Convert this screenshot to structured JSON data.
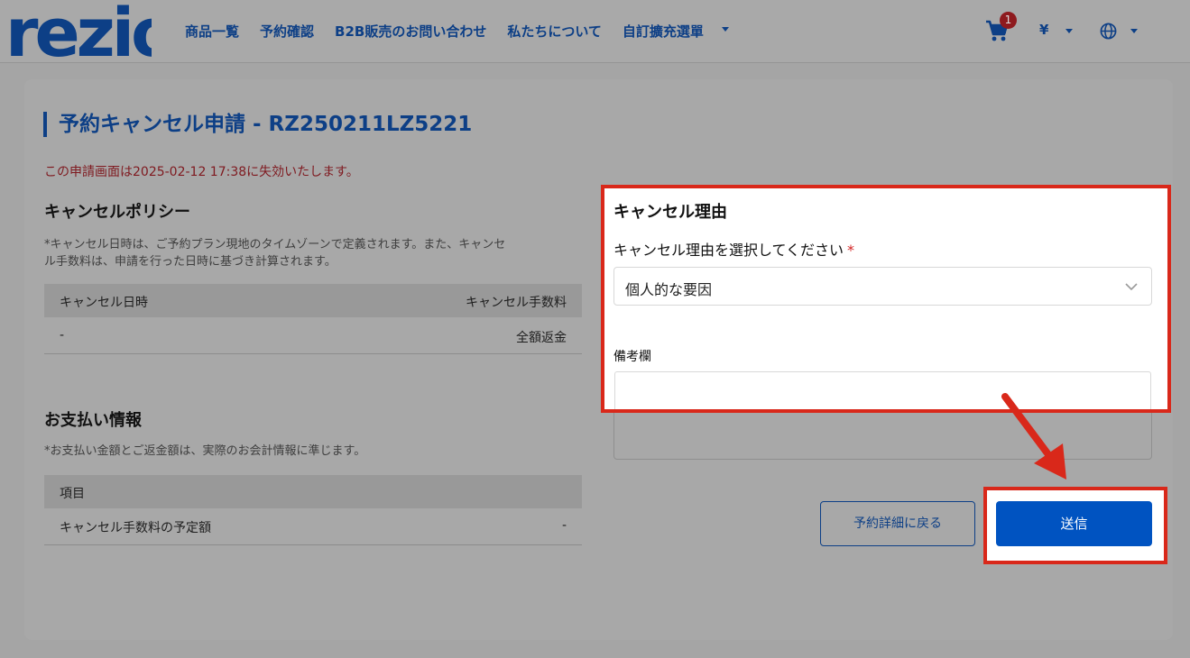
{
  "header": {
    "logo_text": "rezio",
    "nav": [
      "商品一覧",
      "予約確認",
      "B2B販売のお問い合わせ",
      "私たちについて",
      "自訂擴充選單"
    ],
    "cart_count": "1",
    "currency": "¥"
  },
  "page": {
    "title": "予約キャンセル申請 - RZ250211LZ5221",
    "expire_notice": "この申請画面は2025-02-12 17:38に失効いたします。"
  },
  "policy": {
    "heading": "キャンセルポリシー",
    "note_line1": "*キャンセル日時は、ご予約プラン現地のタイムゾーンで定義されます。また、キャンセ",
    "note_line2": "ル手数料は、申請を行った日時に基づき計算されます。",
    "col_date": "キャンセル日時",
    "col_fee": "キャンセル手数料",
    "row_date": "-",
    "row_fee": "全額返金"
  },
  "payment": {
    "heading": "お支払い情報",
    "note": "*お支払い金額とご返金額は、実際のお会計情報に準じます。",
    "col_item": "項目",
    "row_label": "キャンセル手数料の予定額",
    "row_value": "-"
  },
  "form": {
    "title": "キャンセル理由",
    "select_label": "キャンセル理由を選択してください",
    "required_mark": "*",
    "select_value": "個人的な要因",
    "memo_label": "備考欄",
    "memo_value": ""
  },
  "buttons": {
    "back": "予約詳細に戻る",
    "submit": "送信"
  },
  "colors": {
    "brand": "#0d3f86",
    "highlight": "#d9281a",
    "submit": "#0053c1"
  }
}
